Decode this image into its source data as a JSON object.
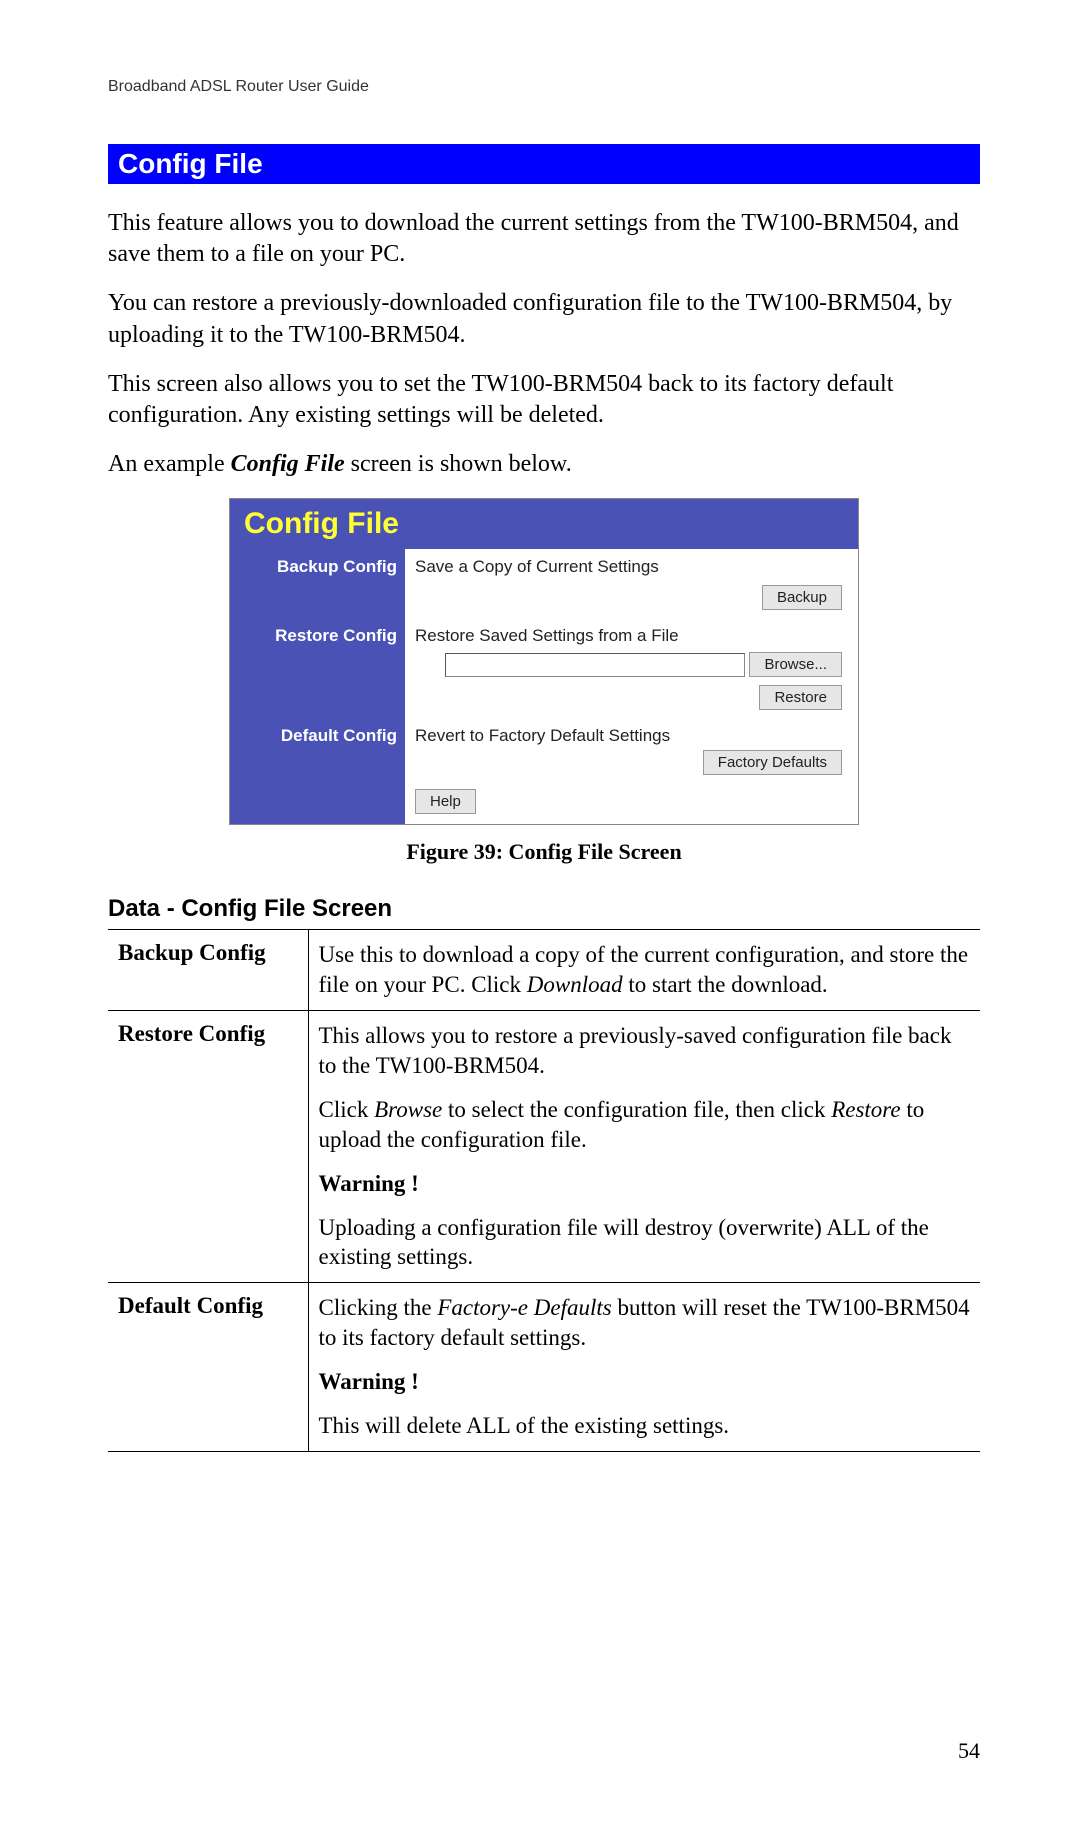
{
  "header": "Broadband ADSL Router User Guide",
  "sectionTitle": "Config File",
  "paras": {
    "p1": "This feature allows you to download the current settings from the TW100-BRM504, and save them to a file on your PC.",
    "p2": "You can restore a previously-downloaded configuration file to the TW100-BRM504, by uploading it to the TW100-BRM504.",
    "p3": "This screen also allows you to set the TW100-BRM504 back to its factory default configuration. Any existing settings will be deleted.",
    "p4a": "An example ",
    "p4b": "Config File",
    "p4c": " screen is shown below."
  },
  "screenshot": {
    "title": "Config File",
    "rows": {
      "backup": {
        "label": "Backup Config",
        "text": "Save a Copy of Current Settings",
        "button": "Backup"
      },
      "restore": {
        "label": "Restore Config",
        "text": "Restore Saved Settings from a File",
        "browse": "Browse...",
        "button": "Restore"
      },
      "default": {
        "label": "Default Config",
        "text": "Revert to Factory Default Settings",
        "button": "Factory Defaults"
      },
      "help": "Help"
    }
  },
  "figureCaption": "Figure 39: Config File Screen",
  "dataHeading": "Data - Config File Screen",
  "table": {
    "r1": {
      "label": "Backup Config",
      "p1a": "Use this to download a copy of the current configuration, and store the file on your PC. Click ",
      "p1b": "Download",
      "p1c": " to start the download."
    },
    "r2": {
      "label": "Restore Config",
      "p1": "This allows you to restore a previously-saved configuration file back to the TW100-BRM504.",
      "p2a": "Click ",
      "p2b": "Browse",
      "p2c": " to select the configuration file, then click ",
      "p2d": "Restore",
      "p2e": " to upload the configuration file.",
      "warn": "Warning !",
      "p3": "Uploading a configuration file will destroy (overwrite) ALL of the existing settings."
    },
    "r3": {
      "label": "Default Config",
      "p1a": "Clicking the ",
      "p1b": "Factory-e Defaults",
      "p1c": " button will reset the TW100-BRM504 to its factory default settings.",
      "warn": "Warning !",
      "p2": "This will delete ALL of the existing settings."
    }
  },
  "pageNumber": "54"
}
